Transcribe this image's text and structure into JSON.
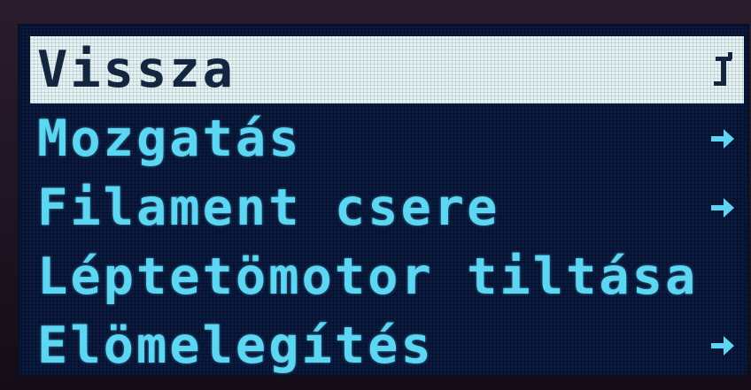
{
  "menu": {
    "items": [
      {
        "label": "Vissza",
        "icon": "arrow-up-return-icon",
        "selected": true
      },
      {
        "label": "Mozgatás",
        "icon": "arrow-right-icon",
        "selected": false
      },
      {
        "label": "Filament csere",
        "icon": "arrow-right-icon",
        "selected": false
      },
      {
        "label": "Léptetömotor tiltása",
        "icon": "",
        "selected": false
      },
      {
        "label": "Elömelegítés",
        "icon": "arrow-right-icon",
        "selected": false
      }
    ]
  },
  "colors": {
    "screen_background": "#0a1a40",
    "text": "#5cd6f2",
    "selected_background": "#e3f2f4",
    "selected_text": "#14253f"
  }
}
